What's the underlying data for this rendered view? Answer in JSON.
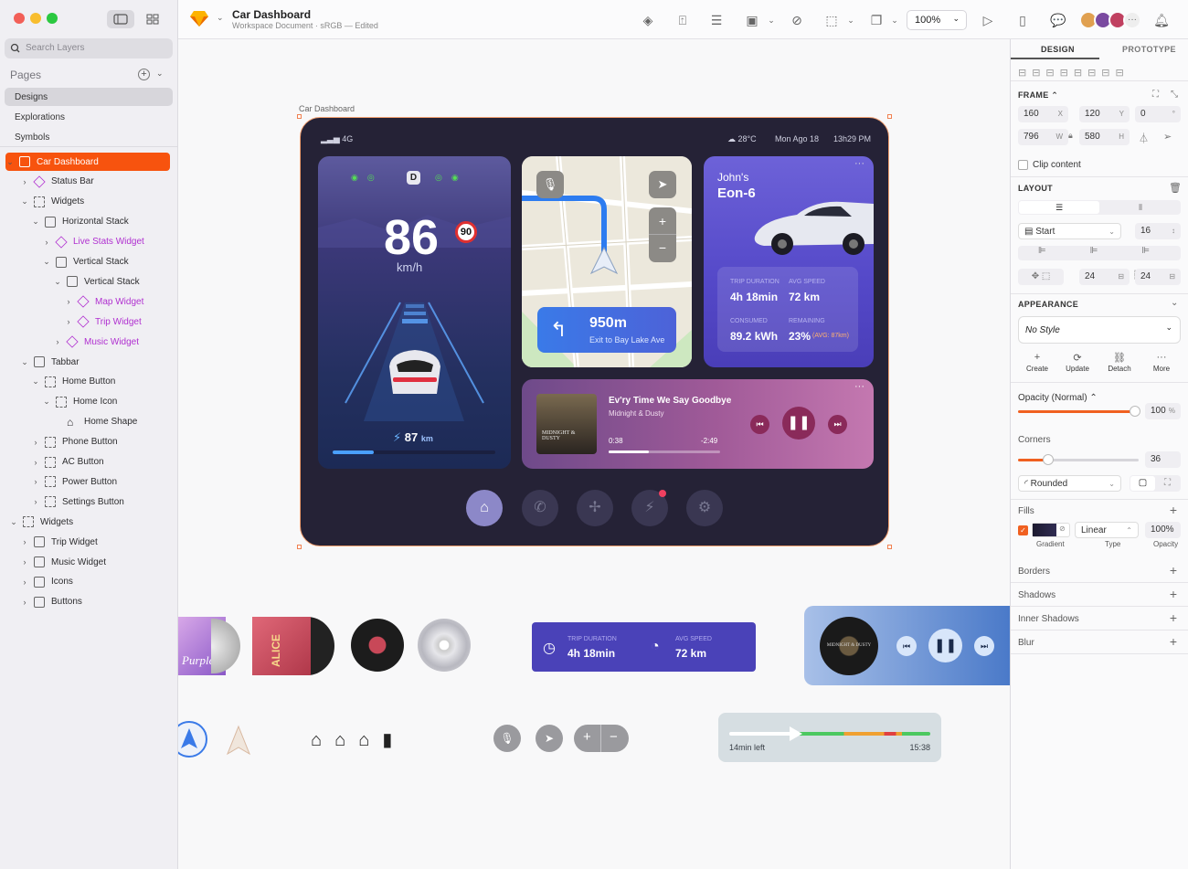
{
  "app": {
    "doc_title": "Car Dashboard",
    "doc_subtitle": "Workspace Document · sRGB — Edited",
    "zoom": "100%"
  },
  "sidebar": {
    "search_placeholder": "Search Layers",
    "pages_title": "Pages",
    "pages": [
      "Designs",
      "Explorations",
      "Symbols"
    ],
    "layers": [
      {
        "label": "Car Dashboard",
        "depth": 0,
        "icon": "stack",
        "active": true,
        "open": true
      },
      {
        "label": "Status Bar",
        "depth": 1,
        "icon": "diamond",
        "open": false
      },
      {
        "label": "Widgets",
        "depth": 1,
        "icon": "frame",
        "open": true
      },
      {
        "label": "Horizontal Stack",
        "depth": 2,
        "icon": "stack",
        "open": true
      },
      {
        "label": "Live Stats Widget",
        "depth": 3,
        "icon": "diamond",
        "comp": true,
        "open": false
      },
      {
        "label": "Vertical Stack",
        "depth": 3,
        "icon": "stack",
        "open": true
      },
      {
        "label": "Vertical Stack",
        "depth": 4,
        "icon": "stack",
        "open": true
      },
      {
        "label": "Map Widget",
        "depth": 5,
        "icon": "diamond",
        "comp": true,
        "open": false
      },
      {
        "label": "Trip Widget",
        "depth": 5,
        "icon": "diamond",
        "comp": true,
        "open": false
      },
      {
        "label": "Music Widget",
        "depth": 4,
        "icon": "diamond",
        "comp": true,
        "open": false
      },
      {
        "label": "Tabbar",
        "depth": 1,
        "icon": "stack",
        "open": true
      },
      {
        "label": "Home Button",
        "depth": 2,
        "icon": "frame",
        "open": true
      },
      {
        "label": "Home Icon",
        "depth": 3,
        "icon": "frame",
        "open": true
      },
      {
        "label": "Home Shape",
        "depth": 4,
        "icon": "home",
        "leaf": true
      },
      {
        "label": "Phone Button",
        "depth": 2,
        "icon": "frame",
        "open": false
      },
      {
        "label": "AC Button",
        "depth": 2,
        "icon": "frame",
        "open": false
      },
      {
        "label": "Power Button",
        "depth": 2,
        "icon": "frame",
        "open": false
      },
      {
        "label": "Settings Button",
        "depth": 2,
        "icon": "frame",
        "open": false
      },
      {
        "label": "Widgets",
        "depth": 0,
        "icon": "frame",
        "open": true
      },
      {
        "label": "Trip Widget",
        "depth": 1,
        "icon": "stack",
        "open": false
      },
      {
        "label": "Music Widget",
        "depth": 1,
        "icon": "stack",
        "open": false
      },
      {
        "label": "Icons",
        "depth": 1,
        "icon": "stack",
        "open": false
      },
      {
        "label": "Buttons",
        "depth": 1,
        "icon": "stack",
        "open": false
      }
    ]
  },
  "canvas": {
    "artboard_label": "Car Dashboard"
  },
  "dash": {
    "signal": "4G",
    "weather": "28°C",
    "date": "Mon Ago 18",
    "time": "13h29 PM",
    "gear": "D",
    "speed": "86",
    "speed_unit": "km/h",
    "limit": "90",
    "range": "87",
    "range_unit": "km",
    "nav_distance": "950m",
    "nav_street": "Exit to Bay Lake Ave",
    "car_owner": "John's",
    "car_model": "Eon-6",
    "trip_duration_label": "TRIP DURATION",
    "trip_duration": "4h 18min",
    "avg_speed_label": "AVG SPEED",
    "avg_speed": "72 km",
    "consumed_label": "CONSUMED",
    "consumed": "89.2 kWh",
    "remaining_label": "REMAINING",
    "remaining": "23%",
    "remaining_note": "(AVG: 87km)",
    "song": "Ev'ry Time We Say Goodbye",
    "artist": "Midnight & Dusty",
    "elapsed": "0:38",
    "remaining_time": "-2:49",
    "album_text": "MIDNIGHT & DUSTY",
    "progress": 0.36,
    "range_progress": 0.25
  },
  "assets": {
    "trip_duration_label": "TRIP DURATION",
    "trip_duration": "4h 18min",
    "avg_speed_label": "AVG SPEED",
    "avg_speed": "72 km",
    "album1_text": "Purple",
    "album2_text": "ALICE",
    "album3_text": "MIDNIGHT & DUSTY",
    "eta_left": "14min left",
    "eta_time": "15:38"
  },
  "panel": {
    "tab_design": "DESIGN",
    "tab_prototype": "PROTOTYPE",
    "frame_label": "FRAME",
    "x": "160",
    "y": "120",
    "rot": "0",
    "w": "796",
    "h": "580",
    "clip": "Clip content",
    "layout_label": "LAYOUT",
    "align": "Start",
    "gap": "16",
    "pad_h": "24",
    "pad_v": "24",
    "appearance_label": "APPEARANCE",
    "style": "No Style",
    "actions": [
      "Create",
      "Update",
      "Detach",
      "More"
    ],
    "opacity_label": "Opacity (Normal)",
    "opacity": "100",
    "opacity_unit": "%",
    "corners_label": "Corners",
    "corners": "36",
    "corner_style": "Rounded",
    "fills_label": "Fills",
    "fill_type": "Linear",
    "fill_opacity": "100%",
    "fill_sub": [
      "Gradient",
      "Type",
      "Opacity"
    ],
    "sections": [
      "Borders",
      "Shadows",
      "Inner Shadows",
      "Blur"
    ]
  }
}
